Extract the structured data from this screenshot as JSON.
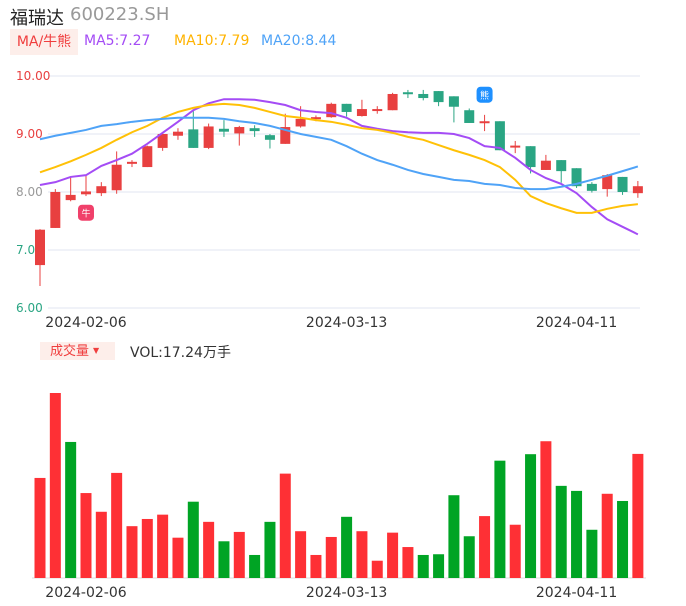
{
  "header": {
    "name": "福瑞达",
    "code": "600223.SH"
  },
  "ma_tab": "MA/牛熊",
  "ma_labels": {
    "ma5": "MA5:7.27",
    "ma10": "MA10:7.79",
    "ma20": "MA20:8.44"
  },
  "colors": {
    "up": "#e84040",
    "down": "#2aa583",
    "vol_up": "#fe3035",
    "vol_down": "#00a424",
    "ma5": "#a44cf5",
    "ma10": "#ffc107",
    "ma20": "#4fa3f7",
    "grid": "#e2e6f0"
  },
  "volume_tab": "成交量",
  "volume_label": "VOL:17.24万手",
  "chart_data": {
    "type": "candlestick",
    "ylim": [
      6,
      10
    ],
    "y_ticks": [
      "10.00",
      "9.00",
      "8.00",
      "7.00",
      "6.00"
    ],
    "x_ticks": [
      {
        "index": 3,
        "label": "2024-02-06"
      },
      {
        "index": 20,
        "label": "2024-03-13"
      },
      {
        "index": 35,
        "label": "2024-04-11"
      }
    ],
    "ohlc": [
      [
        6.74,
        7.35,
        6.38,
        7.36
      ],
      [
        7.38,
        8.0,
        7.38,
        8.05
      ],
      [
        7.86,
        7.95,
        7.84,
        8.26
      ],
      [
        7.96,
        8.01,
        7.93,
        8.3
      ],
      [
        7.98,
        8.1,
        7.93,
        8.17
      ],
      [
        8.03,
        8.47,
        7.97,
        8.7
      ],
      [
        8.49,
        8.52,
        8.43,
        8.55
      ],
      [
        8.43,
        8.79,
        8.43,
        8.8
      ],
      [
        8.76,
        9.0,
        8.71,
        9.03
      ],
      [
        8.97,
        9.04,
        8.9,
        9.1
      ],
      [
        9.08,
        8.76,
        8.76,
        9.4
      ],
      [
        8.76,
        9.13,
        8.74,
        9.18
      ],
      [
        9.09,
        9.04,
        8.95,
        9.24
      ],
      [
        9.01,
        9.12,
        8.8,
        9.14
      ],
      [
        9.1,
        9.05,
        8.95,
        9.15
      ],
      [
        8.98,
        8.9,
        8.75,
        9.0
      ],
      [
        8.83,
        9.12,
        8.83,
        9.35
      ],
      [
        9.13,
        9.26,
        9.11,
        9.48
      ],
      [
        9.26,
        9.29,
        9.22,
        9.32
      ],
      [
        9.29,
        9.52,
        9.28,
        9.54
      ],
      [
        9.52,
        9.38,
        9.3,
        9.52
      ],
      [
        9.31,
        9.43,
        9.3,
        9.59
      ],
      [
        9.4,
        9.43,
        9.35,
        9.48
      ],
      [
        9.41,
        9.69,
        9.41,
        9.71
      ],
      [
        9.72,
        9.7,
        9.62,
        9.76
      ],
      [
        9.69,
        9.62,
        9.58,
        9.76
      ],
      [
        9.74,
        9.55,
        9.48,
        9.74
      ],
      [
        9.65,
        9.47,
        9.2,
        9.65
      ],
      [
        9.41,
        9.19,
        9.19,
        9.44
      ],
      [
        9.19,
        9.22,
        9.05,
        9.33
      ],
      [
        9.22,
        8.72,
        8.72,
        9.22
      ],
      [
        8.78,
        8.8,
        8.67,
        8.88
      ],
      [
        8.79,
        8.43,
        8.32,
        8.79
      ],
      [
        8.38,
        8.54,
        8.38,
        8.64
      ],
      [
        8.55,
        8.36,
        8.16,
        8.55
      ],
      [
        8.41,
        8.1,
        8.07,
        8.41
      ],
      [
        8.14,
        8.02,
        7.99,
        8.17
      ],
      [
        8.05,
        8.29,
        7.92,
        8.31
      ],
      [
        8.26,
        8.0,
        7.95,
        8.26
      ],
      [
        7.98,
        8.1,
        7.9,
        8.19
      ]
    ],
    "ma5": [
      8.12,
      8.17,
      8.26,
      8.29,
      8.45,
      8.55,
      8.66,
      8.83,
      9.02,
      9.21,
      9.41,
      9.53,
      9.6,
      9.6,
      9.59,
      9.55,
      9.5,
      9.41,
      9.38,
      9.36,
      9.28,
      9.14,
      9.09,
      9.05,
      9.03,
      9.02,
      9.02,
      9.0,
      8.93,
      8.79,
      8.76,
      8.59,
      8.38,
      8.24,
      8.14,
      7.98,
      7.74,
      7.53,
      7.4,
      7.27
    ],
    "ma10": [
      8.34,
      8.43,
      8.53,
      8.64,
      8.76,
      8.9,
      9.03,
      9.14,
      9.28,
      9.38,
      9.45,
      9.5,
      9.52,
      9.5,
      9.45,
      9.38,
      9.31,
      9.28,
      9.24,
      9.21,
      9.16,
      9.1,
      9.07,
      9.02,
      8.95,
      8.9,
      8.81,
      8.72,
      8.64,
      8.55,
      8.43,
      8.21,
      7.93,
      7.81,
      7.72,
      7.64,
      7.64,
      7.71,
      7.76,
      7.79
    ],
    "ma20": [
      8.91,
      8.97,
      9.02,
      9.07,
      9.14,
      9.17,
      9.21,
      9.24,
      9.26,
      9.28,
      9.28,
      9.28,
      9.26,
      9.22,
      9.19,
      9.14,
      9.07,
      9.0,
      8.95,
      8.9,
      8.79,
      8.66,
      8.55,
      8.47,
      8.38,
      8.31,
      8.26,
      8.21,
      8.19,
      8.14,
      8.12,
      8.07,
      8.05,
      8.05,
      8.09,
      8.14,
      8.21,
      8.28,
      8.36,
      8.44
    ],
    "volume_wan": [
      13.9,
      25.7,
      18.9,
      11.8,
      9.2,
      14.6,
      7.2,
      8.2,
      8.8,
      5.6,
      10.6,
      7.8,
      5.1,
      6.4,
      3.2,
      7.8,
      14.5,
      6.5,
      3.2,
      5.7,
      8.5,
      6.5,
      2.4,
      6.3,
      4.3,
      3.2,
      3.3,
      11.5,
      5.8,
      8.6,
      16.3,
      7.4,
      17.2,
      19.0,
      12.8,
      12.1,
      6.7,
      11.7,
      10.7,
      17.24
    ],
    "volume_up": [
      1,
      1,
      0,
      1,
      1,
      1,
      1,
      1,
      1,
      1,
      0,
      1,
      0,
      1,
      0,
      0,
      1,
      1,
      1,
      1,
      0,
      1,
      1,
      1,
      1,
      0,
      0,
      0,
      0,
      1,
      0,
      1,
      0,
      1,
      0,
      0,
      0,
      1,
      0,
      1
    ],
    "markers": [
      {
        "index": 3,
        "type": "bull",
        "label": "牛"
      },
      {
        "index": 29,
        "type": "bear",
        "label": "熊"
      }
    ]
  }
}
